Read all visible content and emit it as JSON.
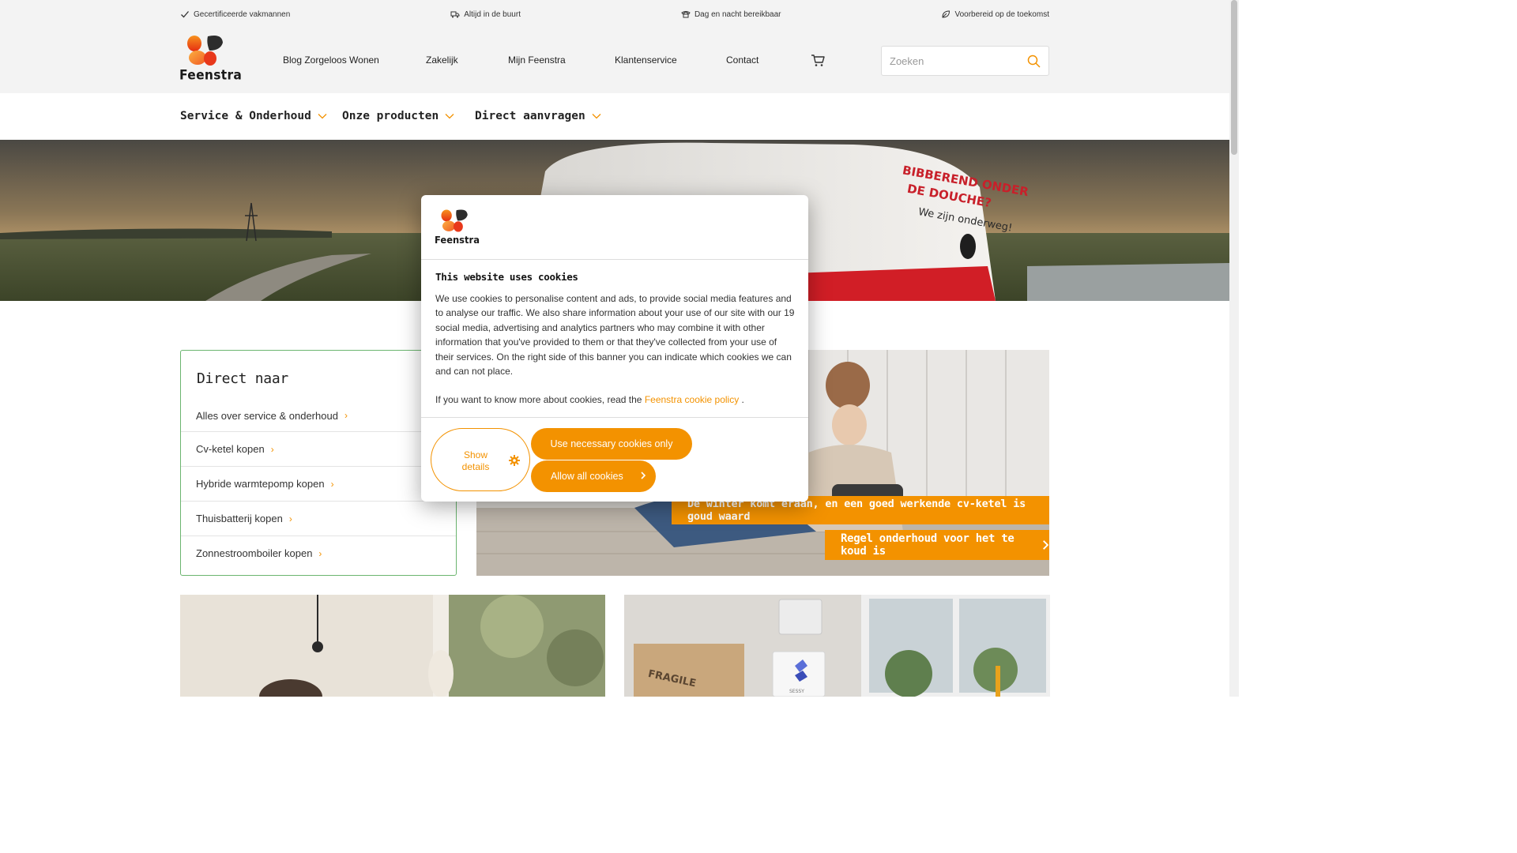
{
  "usps": [
    {
      "icon": "check-icon",
      "label": "Gecertificeerde vakmannen"
    },
    {
      "icon": "van-icon",
      "label": "Altijd in de buurt"
    },
    {
      "icon": "phone-icon",
      "label": "Dag en nacht bereikbaar"
    },
    {
      "icon": "leaf-icon",
      "label": "Voorbereid op de toekomst"
    }
  ],
  "brand": {
    "name": "Feenstra",
    "accent": "#f39200",
    "card_border": "#6bb56f"
  },
  "main_nav": [
    "Blog Zorgeloos Wonen",
    "Zakelijk",
    "Mijn Feenstra",
    "Klantenservice",
    "Contact"
  ],
  "search": {
    "placeholder": "Zoeken"
  },
  "categories": [
    "Service & Onderhoud",
    "Onze producten",
    "Direct aanvragen"
  ],
  "direct": {
    "title": "Direct naar",
    "links": [
      "Alles over service & onderhoud",
      "Cv-ketel kopen",
      "Hybride warmtepomp kopen",
      "Thuisbatterij kopen",
      "Zonnestroomboiler kopen"
    ]
  },
  "hero": {
    "van_text_1": "BIBBEREND ONDER",
    "van_text_2": "DE DOUCHE?",
    "van_text_3": "We zijn onderweg!"
  },
  "promo": {
    "caption": "De winter komt eraan, en een goed werkende cv-ketel is goud waard",
    "button": "Regel onderhoud voor het te koud is"
  },
  "bottom_right_img": {
    "box_text": "FRAGILE",
    "device_text": "SESSY"
  },
  "cookie": {
    "title": "This website uses cookies",
    "body": "We use cookies to personalise content and ads, to provide social media features and to analyse our traffic. We also share information about your use of our site with our 19 social media, advertising and analytics partners who may combine it with other information that you've provided to them or that they've collected from your use of their services. On the right side of this banner you can indicate which cookies we can and can not place.",
    "policy_prefix": "If you want to know more about cookies, read the ",
    "policy_link": "Feenstra cookie policy",
    "policy_suffix": " .",
    "details_line1": "Show",
    "details_line2": "details",
    "necessary_label": "Use necessary cookies only",
    "allow_label": "Allow all cookies"
  }
}
